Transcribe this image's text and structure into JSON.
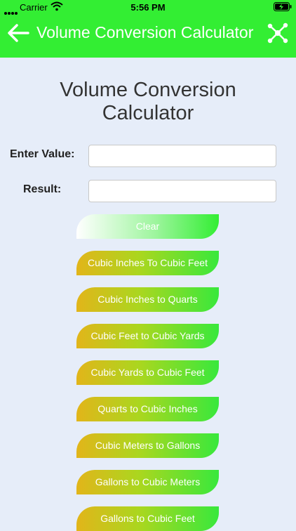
{
  "status_bar": {
    "carrier": "Carrier",
    "time": "5:56 PM"
  },
  "nav": {
    "title": "Volume Conversion Calculator",
    "back_icon": "back-arrow-icon",
    "share_icon": "share-network-icon"
  },
  "page": {
    "title_line1": "Volume Conversion",
    "title_line2": "Calculator",
    "enter_value_label": "Enter Value:",
    "result_label": "Result:",
    "enter_value": "",
    "result_value": ""
  },
  "buttons": {
    "clear": "Clear",
    "b1": "Cubic Inches To Cubic Feet",
    "b2": "Cubic Inches to Quarts",
    "b3": "Cubic Feet to Cubic Yards",
    "b4": "Cubic Yards to Cubic Feet",
    "b5": "Quarts to Cubic Inches",
    "b6": "Cubic Meters to Gallons",
    "b7": "Gallons to Cubic Meters",
    "b8": "Gallons to Cubic Feet"
  },
  "colors": {
    "header": "#33ee33",
    "background": "#e6edf9",
    "button_start": "#e2b51a",
    "button_end": "#38e83c"
  }
}
